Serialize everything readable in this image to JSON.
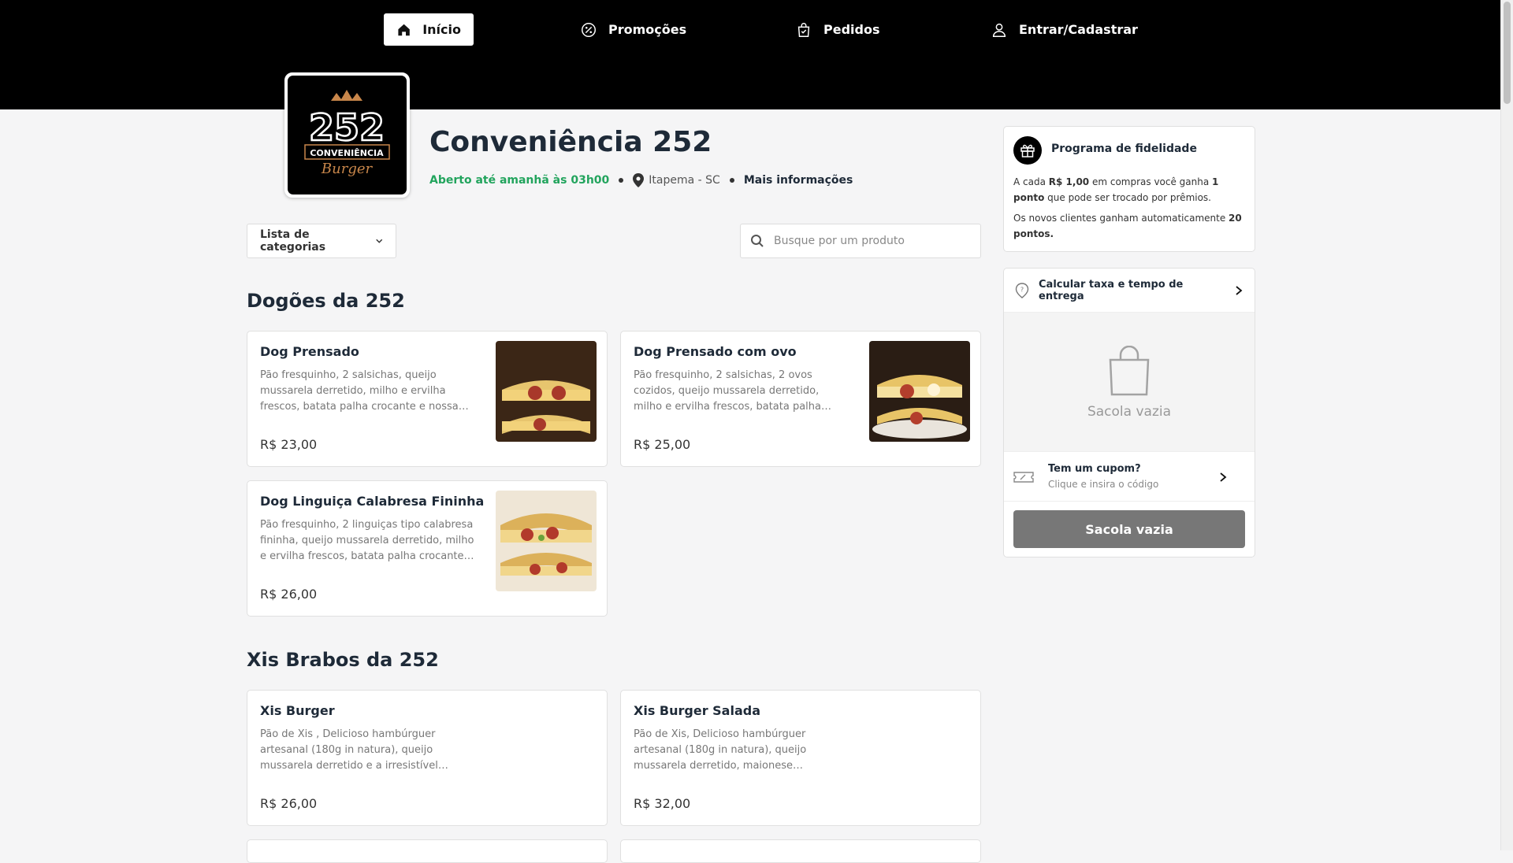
{
  "nav": {
    "home": "Início",
    "promos": "Promoções",
    "orders": "Pedidos",
    "login": "Entrar/Cadastrar"
  },
  "store": {
    "name": "Conveniência 252",
    "status": "Aberto até amanhã às 03h00",
    "location": "Itapema - SC",
    "more_info": "Mais informações",
    "logo_number": "252",
    "logo_line1": "CONVENIÊNCIA",
    "logo_line2": "Burger"
  },
  "filters": {
    "category_label": "Lista de categorias",
    "search_placeholder": "Busque por um produto"
  },
  "sections": [
    {
      "title": "Dogões da 252",
      "items": [
        {
          "name": "Dog Prensado",
          "desc": "Pão fresquinho, 2 salsichas, queijo mussarela derretido, milho e ervilha frescos, batata palha crocante e nossa…",
          "price": "R$ 23,00"
        },
        {
          "name": "Dog Prensado com ovo",
          "desc": "Pão fresquinho, 2 salsichas, 2 ovos cozidos, queijo mussarela derretido, milho e ervilha frescos, batata palha crocante e…",
          "price": "R$ 25,00"
        },
        {
          "name": "Dog Linguiça Calabresa Fininha",
          "desc": "Pão fresquinho, 2 linguiças tipo calabresa fininha, queijo mussarela derretido, milho e ervilha frescos, batata palha crocante e…",
          "price": "R$ 26,00"
        }
      ]
    },
    {
      "title": "Xis Brabos da 252",
      "items": [
        {
          "name": "Xis Burger",
          "desc": "Pão de Xis , Delicioso hambúrguer artesanal (180g in natura), queijo mussarela derretido e a irresistível…",
          "price": "R$ 26,00"
        },
        {
          "name": "Xis Burger Salada",
          "desc": "Pão de Xis, Delicioso hambúrguer artesanal (180g in natura), queijo mussarela derretido, maionese caseira da…",
          "price": "R$ 32,00"
        }
      ]
    }
  ],
  "loyalty": {
    "title": "Programa de fidelidade",
    "line1_pre": "A cada ",
    "line1_bold1": "R$ 1,00",
    "line1_mid": " em compras você ganha ",
    "line1_bold2": "1 ponto",
    "line1_post": " que pode ser trocado por prêmios.",
    "line2_pre": "Os novos clientes ganham automaticamente ",
    "line2_bold": "20 pontos."
  },
  "cart": {
    "delivery_label": "Calcular taxa e tempo de entrega",
    "empty_label": "Sacola vazia",
    "coupon_title": "Tem um cupom?",
    "coupon_sub": "Clique e insira o código",
    "button_label": "Sacola vazia"
  },
  "icons": [
    "home-icon",
    "percent-badge-icon",
    "shopping-bag-icon",
    "user-icon",
    "map-pin-icon",
    "chevron-down-icon",
    "search-icon",
    "gift-icon",
    "location-question-icon",
    "chevron-right-icon",
    "coupon-icon"
  ],
  "colors": {
    "topbar": "#000000",
    "open_status": "#22a45d",
    "button_disabled": "#777777"
  }
}
